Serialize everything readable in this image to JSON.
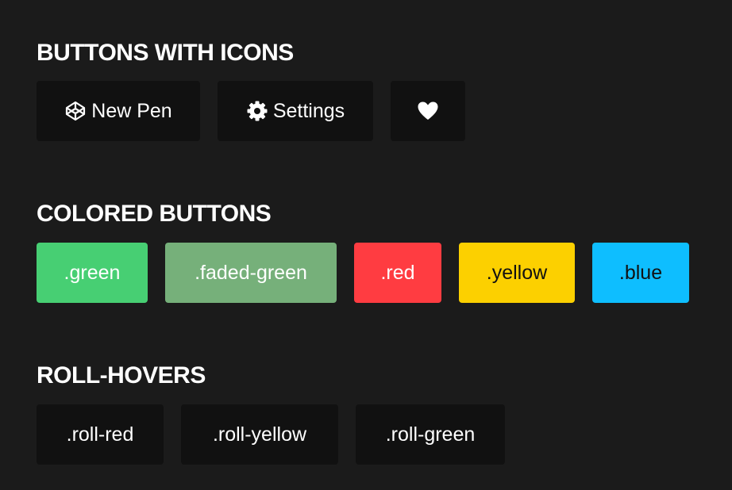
{
  "sections": {
    "icons": {
      "title": "BUTTONS WITH ICONS",
      "buttons": [
        {
          "label": "New Pen",
          "icon": "codepen-icon"
        },
        {
          "label": "Settings",
          "icon": "gear-icon"
        },
        {
          "label": "",
          "icon": "heart-icon"
        }
      ]
    },
    "colored": {
      "title": "COLORED BUTTONS",
      "buttons": [
        {
          "label": ".green",
          "color": "#47cf73"
        },
        {
          "label": ".faded-green",
          "color": "#76b07a"
        },
        {
          "label": ".red",
          "color": "#ff3c41"
        },
        {
          "label": ".yellow",
          "color": "#fcd000"
        },
        {
          "label": ".blue",
          "color": "#0ebeff"
        }
      ]
    },
    "roll": {
      "title": "ROLL-HOVERS",
      "buttons": [
        {
          "label": ".roll-red"
        },
        {
          "label": ".roll-yellow"
        },
        {
          "label": ".roll-green"
        }
      ]
    }
  },
  "colors": {
    "background": "#1b1b1b",
    "dark_button": "#111111",
    "text": "#ffffff"
  }
}
